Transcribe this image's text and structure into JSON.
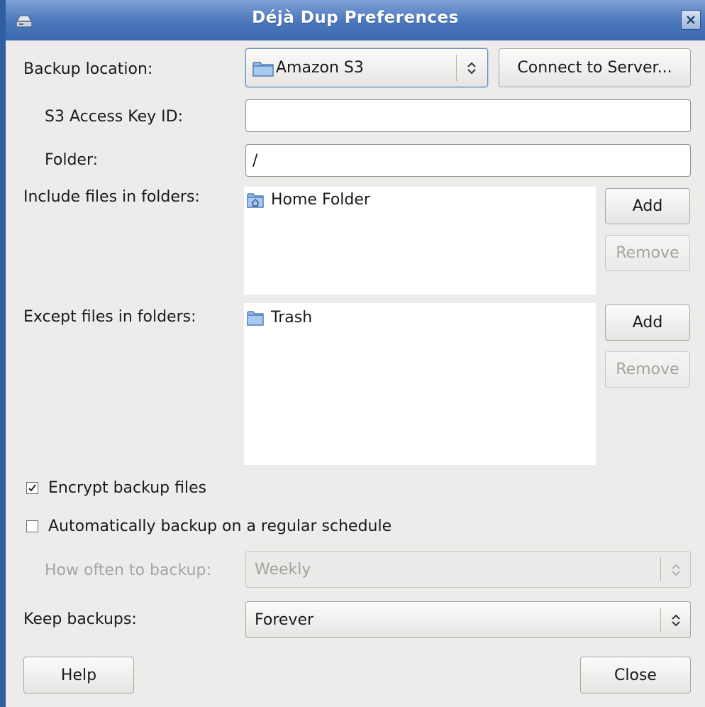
{
  "window": {
    "title": "Déjà Dup Preferences"
  },
  "backup_location": {
    "label": "Backup location:",
    "value": "Amazon S3",
    "connect_button": "Connect to Server..."
  },
  "s3_key": {
    "label": "S3 Access Key ID:",
    "value": ""
  },
  "folder": {
    "label": "Folder:",
    "value": "/"
  },
  "include": {
    "label": "Include files in folders:",
    "items": [
      "Home Folder"
    ],
    "add_label": "Add",
    "remove_label": "Remove"
  },
  "exclude": {
    "label": "Except files in folders:",
    "items": [
      "Trash"
    ],
    "add_label": "Add",
    "remove_label": "Remove"
  },
  "encrypt": {
    "label": "Encrypt backup files",
    "checked": true
  },
  "auto_backup": {
    "label": "Automatically backup on a regular schedule",
    "checked": false
  },
  "how_often": {
    "label": "How often to backup:",
    "value": "Weekly"
  },
  "keep": {
    "label": "Keep backups:",
    "value": "Forever"
  },
  "footer": {
    "help_label": "Help",
    "close_label": "Close"
  },
  "colors": {
    "titlebar": "#4d79bd",
    "desktop": "#2f5fa0",
    "folder_icon": "#6fa3dc"
  }
}
